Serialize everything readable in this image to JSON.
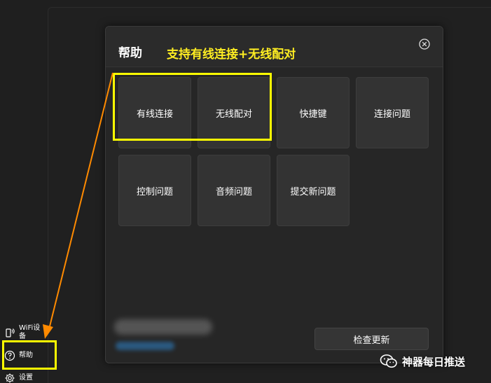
{
  "sidebar": {
    "items": [
      {
        "label": "WiFi设备",
        "icon": "phone-wifi-icon"
      },
      {
        "label": "帮助",
        "icon": "question-circle-icon"
      },
      {
        "label": "设置",
        "icon": "gear-icon"
      }
    ]
  },
  "dialog": {
    "title": "帮助",
    "annotation": "支持有线连接+无线配对",
    "close_icon": "close-circle-icon",
    "tiles": [
      {
        "label": "有线连接"
      },
      {
        "label": "无线配对"
      },
      {
        "label": "快捷键"
      },
      {
        "label": "连接问题"
      },
      {
        "label": "控制问题"
      },
      {
        "label": "音频问题"
      },
      {
        "label": "提交新问题"
      }
    ],
    "update_button": "检查更新"
  },
  "watermark": {
    "text": "神器每日推送",
    "icon": "wechat-icon"
  },
  "colors": {
    "highlight": "#ffff00",
    "annotation_text": "#ffee22",
    "arrow": "#ff8a00",
    "background": "#1f1f1f",
    "tile": "#333333"
  }
}
